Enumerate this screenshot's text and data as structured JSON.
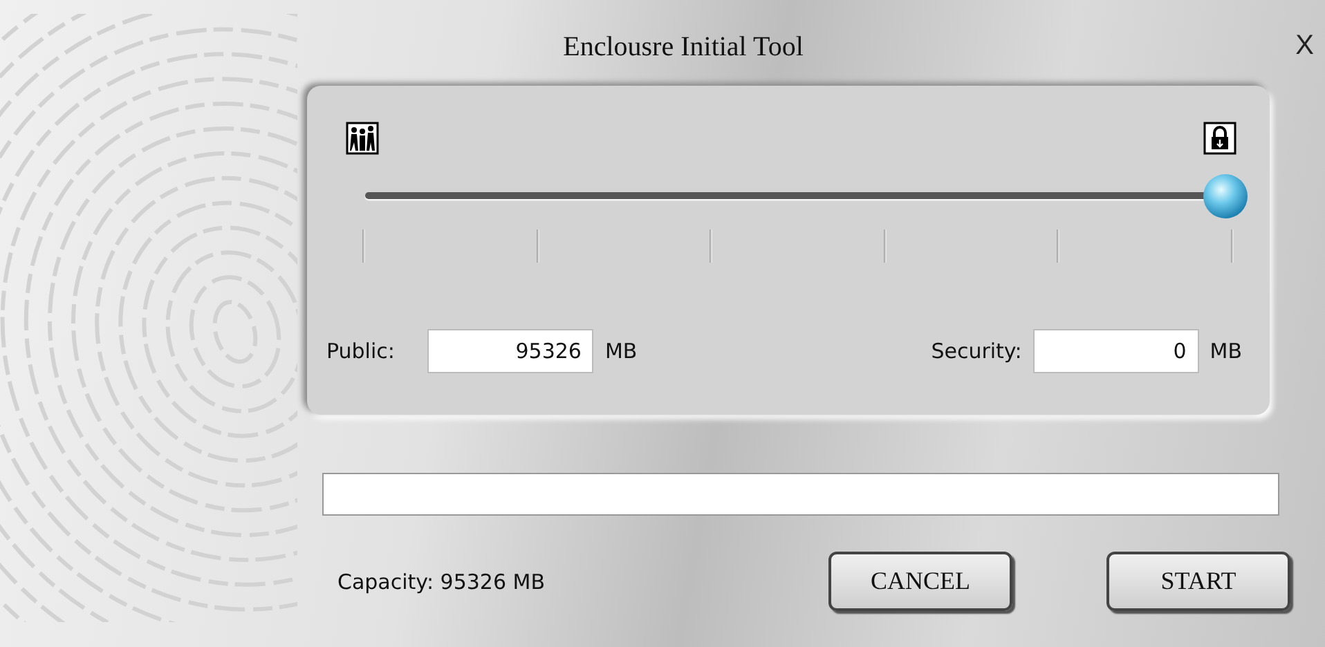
{
  "window": {
    "title": "Enclousre Initial Tool",
    "close_label": "X"
  },
  "slider": {
    "level": 1
  },
  "fields": [
    {
      "label": "Public:",
      "value": "95326",
      "unit": "MB"
    },
    {
      "label": "Security:",
      "value": "0",
      "unit": "MB"
    }
  ],
  "progress": {
    "level": 0
  },
  "capacity": "Capacity: 95326 MB",
  "buttons": [
    {
      "label": "CANCEL"
    },
    {
      "label": "START"
    }
  ]
}
